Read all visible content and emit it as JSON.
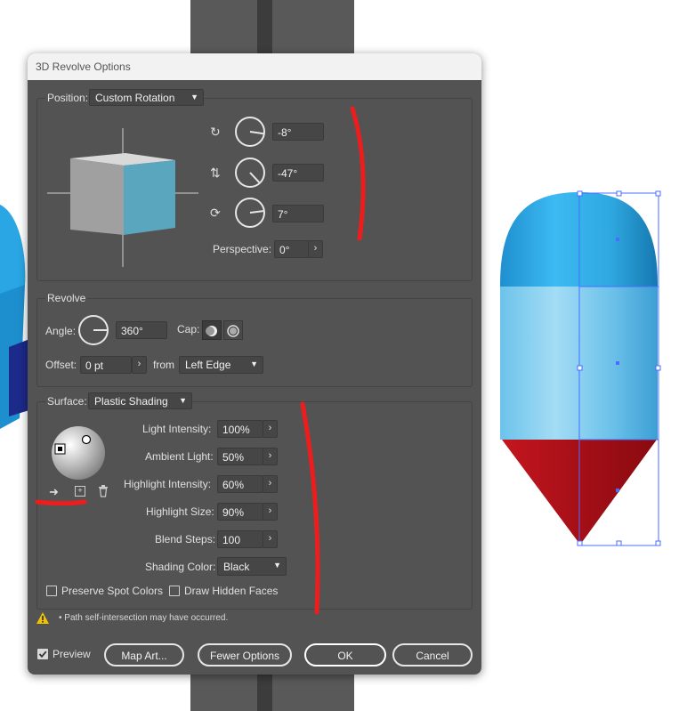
{
  "dialog": {
    "title": "3D Revolve Options"
  },
  "position": {
    "label": "Position:",
    "preset": "Custom Rotation",
    "rotation_x": "-8°",
    "rotation_y": "-47°",
    "rotation_z": "7°",
    "perspective_label": "Perspective:",
    "perspective": "0°"
  },
  "revolve": {
    "group_label": "Revolve",
    "angle_label": "Angle:",
    "angle": "360°",
    "cap_label": "Cap:",
    "offset_label": "Offset:",
    "offset": "0 pt",
    "from_label": "from",
    "from_value": "Left Edge"
  },
  "surface": {
    "label": "Surface:",
    "value": "Plastic Shading",
    "light_intensity_label": "Light Intensity:",
    "light_intensity": "100%",
    "ambient_light_label": "Ambient Light:",
    "ambient_light": "50%",
    "highlight_intensity_label": "Highlight Intensity:",
    "highlight_intensity": "60%",
    "highlight_size_label": "Highlight Size:",
    "highlight_size": "90%",
    "blend_steps_label": "Blend Steps:",
    "blend_steps": "100",
    "shading_color_label": "Shading Color:",
    "shading_color": "Black",
    "preserve_spot_label": "Preserve Spot Colors",
    "draw_hidden_label": "Draw Hidden Faces"
  },
  "warning": "• Path self-intersection may have occurred.",
  "footer": {
    "preview_label": "Preview",
    "map_art_label": "Map Art...",
    "fewer_options_label": "Fewer Options",
    "ok_label": "OK",
    "cancel_label": "Cancel"
  },
  "colors": {
    "dialog_bg": "#535353",
    "cube_side": "#5ba6bf",
    "capsule_blue": "#2fa8e0",
    "capsule_red": "#b3141c",
    "annotation_red": "#ee1d1d",
    "selection_blue": "#4a6cff"
  },
  "stepper_icon": "›"
}
